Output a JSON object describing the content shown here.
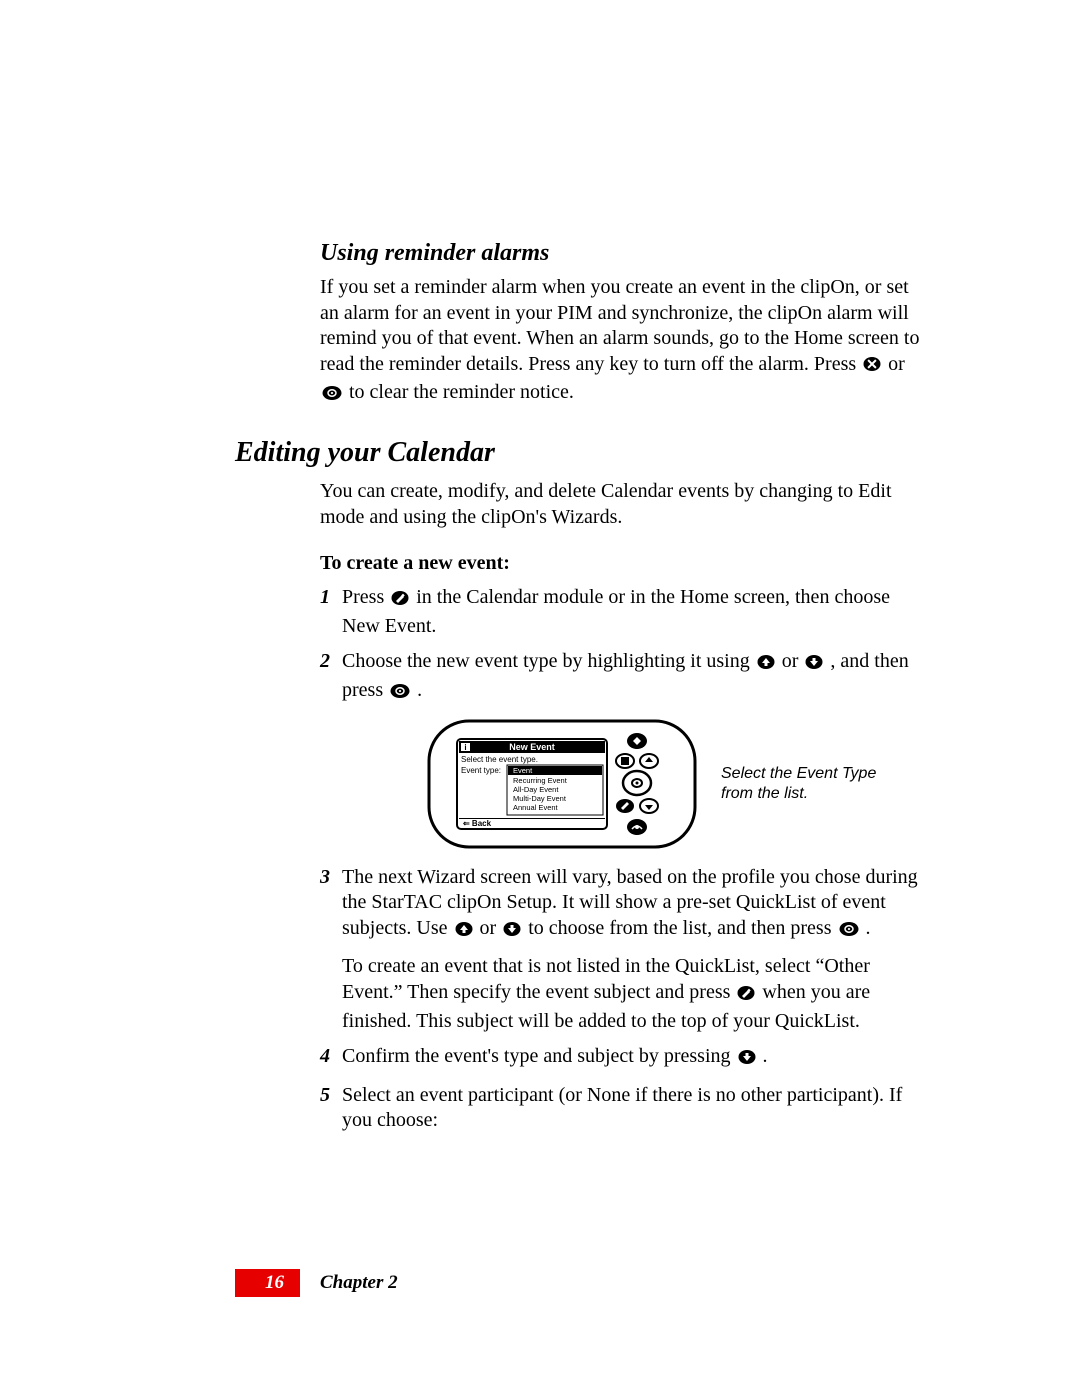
{
  "section1": {
    "heading": "Using reminder alarms",
    "para_a": "If you set a reminder alarm when you create an event in the clipOn, or set an alarm for an event in your PIM and synchronize, the clipOn alarm will remind you of that event. When an alarm sounds, go to the Home screen to read the reminder details. Press any key to turn off the alarm. Press ",
    "para_b": " or ",
    "para_c": " to clear the reminder notice."
  },
  "section2": {
    "heading": "Editing your Calendar",
    "intro": "You can create, modify, and delete Calendar events by changing to Edit mode and using the clipOn's Wizards.",
    "sub": "To create a new event:",
    "steps": {
      "s1a": "Press ",
      "s1b": " in the Calendar module or in the Home screen, then choose New Event.",
      "s2a": "Choose the new event type by highlighting it using ",
      "s2b": " or ",
      "s2c": ", and then press ",
      "s2d": ".",
      "s3a": "The next Wizard screen will vary, based on the profile you chose during the StarTAC clipOn Setup. It will show a pre-set QuickList of event subjects. Use ",
      "s3b": " or ",
      "s3c": " to choose from the list, and then press ",
      "s3d": ".",
      "s3e": "To create an event that is not listed in the QuickList, select “Other Event.” Then specify the event subject and press ",
      "s3f": " when you are finished. This subject will be added to the top of your QuickList.",
      "s4a": "Confirm the event's type and subject by pressing ",
      "s4b": ".",
      "s5": "Select an event participant (or None if there is no other participant). If you choose:"
    }
  },
  "device": {
    "title": "New Event",
    "subtitle": "Select the event type.",
    "label": "Event type:",
    "opt0": "Event",
    "opt1": "Recurring Event",
    "opt2": "All-Day Event",
    "opt3": "Multi-Day Event",
    "opt4": "Annual Event",
    "back": "⇐ Back",
    "caption": "Select the Event Type from the list."
  },
  "footer": {
    "page": "16",
    "chapter": "Chapter 2"
  },
  "step_labels": {
    "n1": "1",
    "n2": "2",
    "n3": "3",
    "n4": "4",
    "n5": "5"
  }
}
